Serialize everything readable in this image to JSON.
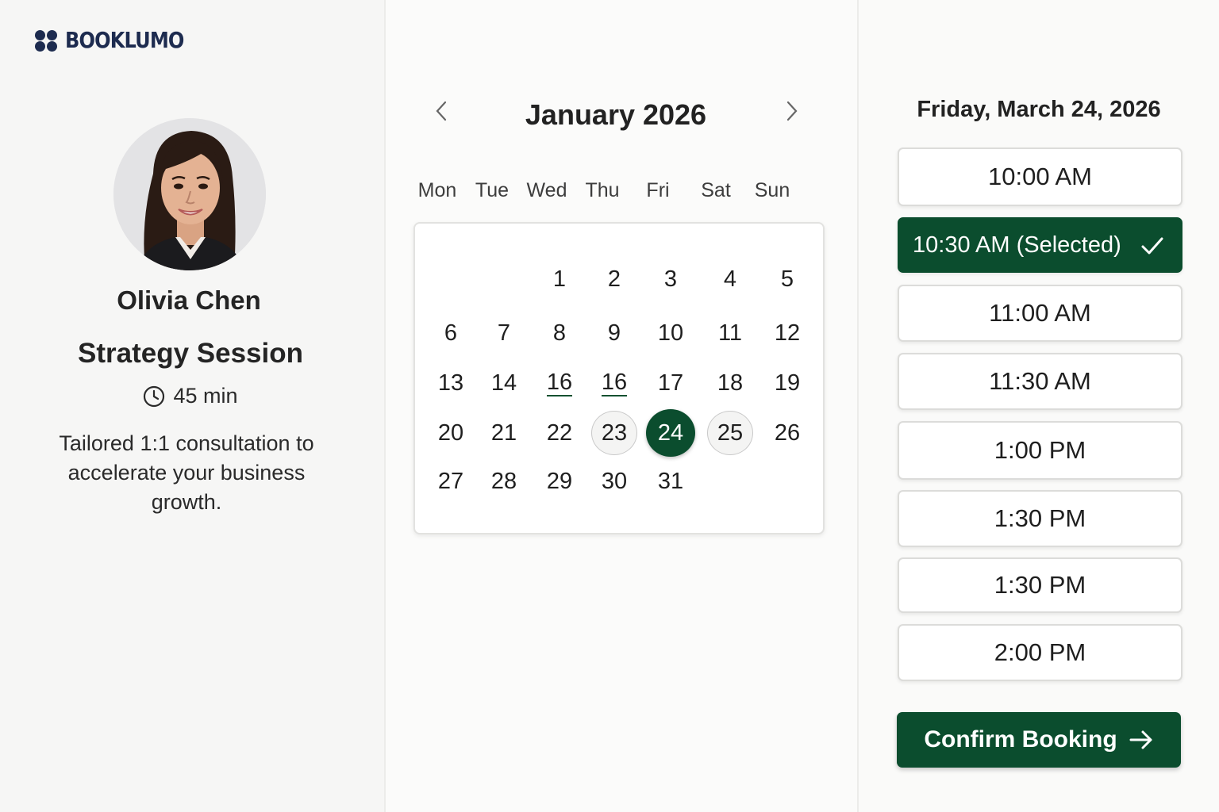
{
  "brand": {
    "name": "BOOKLUMO",
    "color": "#1d2b4f"
  },
  "host": {
    "name": "Olivia Chen"
  },
  "event": {
    "title": "Strategy Session",
    "duration": "45 min",
    "description": "Tailored 1:1 consultation to accelerate your business growth."
  },
  "calendar": {
    "month_label": "January 2026",
    "weekdays": [
      "Mon",
      "Tue",
      "Wed",
      "Thu",
      "Fri",
      "Sat",
      "Sun"
    ],
    "days": [
      {
        "label": "1",
        "row": 0,
        "col": 2
      },
      {
        "label": "2",
        "row": 0,
        "col": 3
      },
      {
        "label": "3",
        "row": 0,
        "col": 4
      },
      {
        "label": "4",
        "row": 0,
        "col": 5
      },
      {
        "label": "5",
        "row": 0,
        "col": 6
      },
      {
        "label": "6",
        "row": 1,
        "col": 0
      },
      {
        "label": "7",
        "row": 1,
        "col": 1
      },
      {
        "label": "8",
        "row": 1,
        "col": 2
      },
      {
        "label": "9",
        "row": 1,
        "col": 3
      },
      {
        "label": "10",
        "row": 1,
        "col": 4
      },
      {
        "label": "11",
        "row": 1,
        "col": 5
      },
      {
        "label": "12",
        "row": 1,
        "col": 6
      },
      {
        "label": "13",
        "row": 2,
        "col": 0
      },
      {
        "label": "14",
        "row": 2,
        "col": 1
      },
      {
        "label": "16",
        "row": 2,
        "col": 2,
        "state": "underline"
      },
      {
        "label": "16",
        "row": 2,
        "col": 3,
        "state": "underline"
      },
      {
        "label": "17",
        "row": 2,
        "col": 4
      },
      {
        "label": "18",
        "row": 2,
        "col": 5
      },
      {
        "label": "19",
        "row": 2,
        "col": 6
      },
      {
        "label": "20",
        "row": 3,
        "col": 0
      },
      {
        "label": "21",
        "row": 3,
        "col": 1
      },
      {
        "label": "22",
        "row": 3,
        "col": 2
      },
      {
        "label": "23",
        "row": 3,
        "col": 3,
        "state": "ringed"
      },
      {
        "label": "24",
        "row": 3,
        "col": 4,
        "state": "selected"
      },
      {
        "label": "25",
        "row": 3,
        "col": 5,
        "state": "ringed"
      },
      {
        "label": "26",
        "row": 3,
        "col": 6
      },
      {
        "label": "27",
        "row": 4,
        "col": 0
      },
      {
        "label": "28",
        "row": 4,
        "col": 1
      },
      {
        "label": "29",
        "row": 4,
        "col": 2
      },
      {
        "label": "30",
        "row": 4,
        "col": 3
      },
      {
        "label": "31",
        "row": 4,
        "col": 4
      }
    ]
  },
  "times": {
    "date_heading": "Friday, March 24, 2026",
    "slots": [
      {
        "label": "10:00 AM"
      },
      {
        "label": "10:30 AM (Selected)",
        "selected": true
      },
      {
        "label": "11:00 AM"
      },
      {
        "label": "11:30 AM"
      },
      {
        "label": "1:00 PM"
      },
      {
        "label": "1:30 PM"
      },
      {
        "label": "1:30 PM"
      },
      {
        "label": "2:00 PM"
      }
    ]
  },
  "confirm_label": "Confirm Booking",
  "colors": {
    "accent": "#0b4d2e",
    "panel": "#f6f6f5"
  }
}
